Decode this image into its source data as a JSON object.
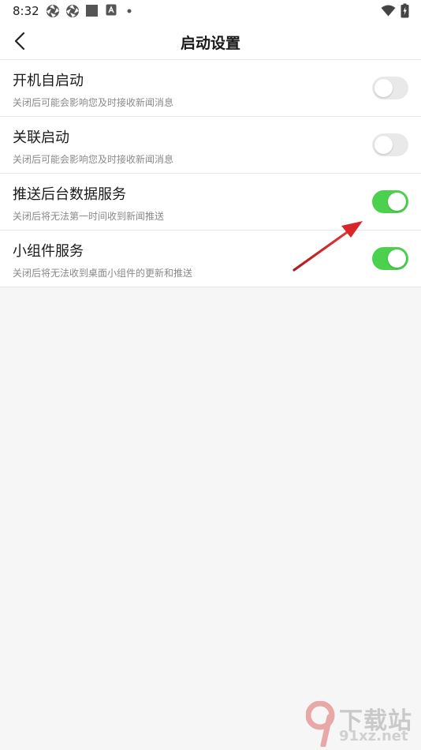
{
  "status_bar": {
    "time": "8:32",
    "left_icons": [
      "aperture-icon",
      "aperture-icon",
      "square-icon",
      "app-icon",
      "dot-icon"
    ],
    "right_icons": [
      "wifi-icon",
      "battery-icon"
    ]
  },
  "header": {
    "back_icon": "chevron-left-icon",
    "title": "启动设置"
  },
  "settings": [
    {
      "title": "开机自启动",
      "description": "关闭后可能会影响您及时接收新闻消息",
      "enabled": false
    },
    {
      "title": "关联启动",
      "description": "关闭后可能会影响您及时接收新闻消息",
      "enabled": false
    },
    {
      "title": "推送后台数据服务",
      "description": "关闭后将无法第一时间收到新闻推送",
      "enabled": true
    },
    {
      "title": "小组件服务",
      "description": "关闭后将无法收到桌面小组件的更新和推送",
      "enabled": true
    }
  ],
  "colors": {
    "toggle_on": "#4cd14f",
    "toggle_off": "#e9e9e9",
    "annotation_arrow": "#d9262b",
    "background": "#f6f6f6"
  },
  "watermark": {
    "brand": "下载站",
    "domain": "91xz.net"
  }
}
